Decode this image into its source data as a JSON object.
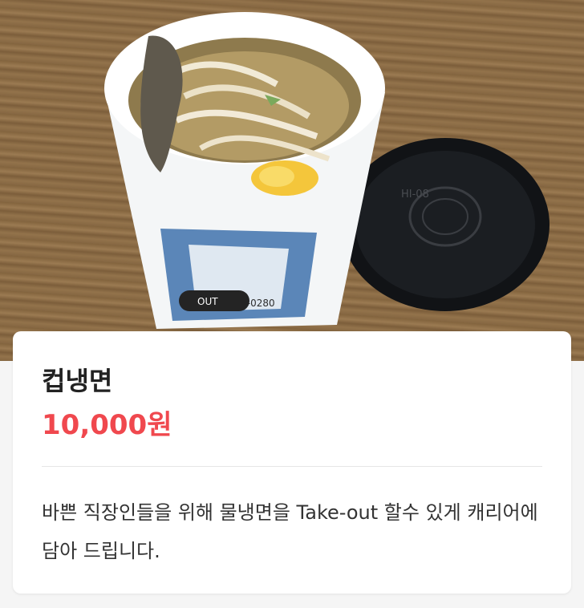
{
  "product": {
    "image_alt": "컵냉면 takeout cup with lid",
    "name": "컵냉면",
    "price": "10,000원",
    "description": "바쁜 직장인들을 위해 물냉면을 Take-out 할수 있게 캐리어에 담아 드립니다."
  },
  "photo_labels": {
    "cup_side_text": "021508-0280",
    "cup_bottom_text": "OUT",
    "lid_text": "HI-08"
  },
  "colors": {
    "price": "#f0484e",
    "title": "#222222",
    "description": "#333333",
    "card_background": "#ffffff",
    "page_background": "#f5f5f5"
  }
}
